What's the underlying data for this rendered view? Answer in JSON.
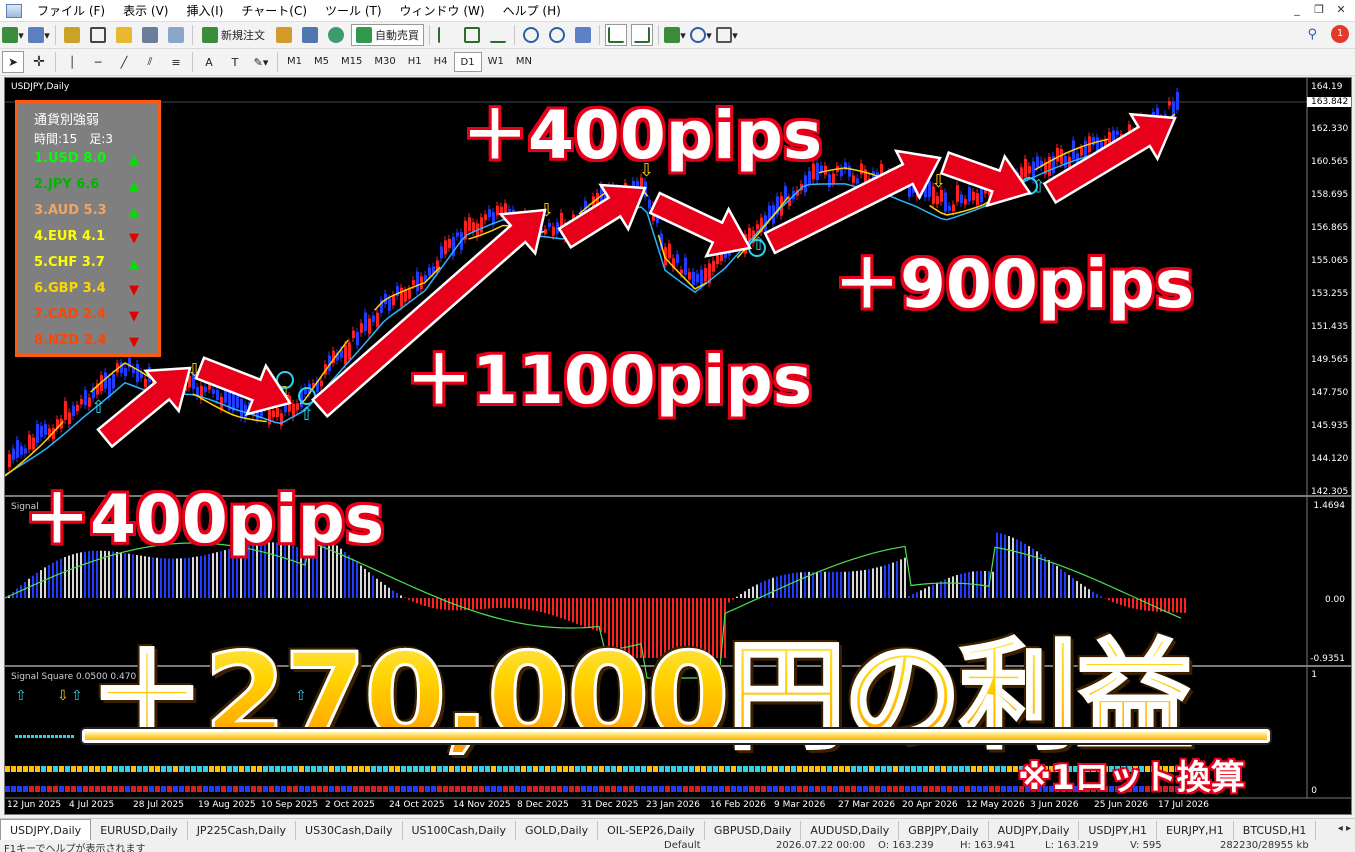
{
  "menu": [
    "ファイル (F)",
    "表示 (V)",
    "挿入(I)",
    "チャート(C)",
    "ツール (T)",
    "ウィンドウ (W)",
    "ヘルプ (H)"
  ],
  "toolbar": {
    "new_order": "新規注文",
    "auto_trade": "自動売買"
  },
  "notification_count": "1",
  "timeframes": [
    "M1",
    "M5",
    "M15",
    "M30",
    "H1",
    "H4",
    "D1",
    "W1",
    "MN"
  ],
  "active_timeframe": "D1",
  "chart": {
    "title": "USDJPY,Daily",
    "current_price": "163.842",
    "price_labels": [
      "164.19",
      "162.330",
      "160.565",
      "158.695",
      "156.865",
      "155.065",
      "153.255",
      "151.435",
      "149.565",
      "147.750",
      "145.935",
      "144.120",
      "142.305"
    ],
    "time_labels": [
      "12 Jun 2025",
      "4 Jul 2025",
      "28 Jul 2025",
      "19 Aug 2025",
      "10 Sep 2025",
      "2 Oct 2025",
      "24 Oct 2025",
      "14 Nov 2025",
      "8 Dec 2025",
      "31 Dec 2025",
      "23 Jan 2026",
      "16 Feb 2026",
      "9 Mar 2026",
      "27 Mar 2026",
      "20 Apr 2026",
      "12 May 2026",
      "3 Jun 2026",
      "25 Jun 2026",
      "17 Jul 2026"
    ],
    "sub1_label": "Signal",
    "sub1_max": "1.4694",
    "sub1_zero": "0.00",
    "sub1_min": "-0.9351",
    "sub2_label": "Signal Square 0.0500 0.470",
    "sub2_top": "1",
    "sub2_bottom": "0"
  },
  "strength": {
    "title": "通貨別強弱",
    "subtitle": "時間:15　足:3",
    "rows": [
      {
        "label": "1.USD 8.0",
        "color": "#00ff00",
        "dir": "up"
      },
      {
        "label": "2.JPY  6.6",
        "color": "#00b400",
        "dir": "up"
      },
      {
        "label": "3.AUD 5.3",
        "color": "#f4a460",
        "dir": "up"
      },
      {
        "label": "4.EUR 4.1",
        "color": "#ffff00",
        "dir": "down"
      },
      {
        "label": "5.CHF  3.7",
        "color": "#ffff00",
        "dir": "up"
      },
      {
        "label": "6.GBP 3.4",
        "color": "#ffd700",
        "dir": "down"
      },
      {
        "label": "7.CAD 2.4",
        "color": "#ff4500",
        "dir": "down"
      },
      {
        "label": "8.NZD 2.4",
        "color": "#ff4500",
        "dir": "down"
      }
    ],
    "up_glyph": "▲",
    "down_glyph": "▼"
  },
  "overlay": {
    "pips1": "＋400pips",
    "pips2": "＋1100pips",
    "pips3": "＋400pips",
    "pips4": "＋900pips",
    "profit": "＋270,000円の利益",
    "note": "※1ロット換算"
  },
  "tabs": [
    "USDJPY,Daily",
    "EURUSD,Daily",
    "JP225Cash,Daily",
    "US30Cash,Daily",
    "US100Cash,Daily",
    "GOLD,Daily",
    "OIL-SEP26,Daily",
    "GBPUSD,Daily",
    "AUDUSD,Daily",
    "GBPJPY,Daily",
    "AUDJPY,Daily",
    "USDJPY,H1",
    "EURJPY,H1",
    "BTCUSD,H1"
  ],
  "active_tab": "USDJPY,Daily",
  "status": {
    "help": "F1キーでヘルプが表示されます",
    "profile": "Default",
    "datetime": "2026.07.22 00:00",
    "o": "O: 163.239",
    "h": "H: 163.941",
    "l": "L: 163.219",
    "v": "V: 595",
    "traffic": "282230/28955 kb"
  },
  "colors": {
    "accent_red": "#e8001a",
    "gold": "#ffd400",
    "panel_orange": "#ff5a14"
  }
}
